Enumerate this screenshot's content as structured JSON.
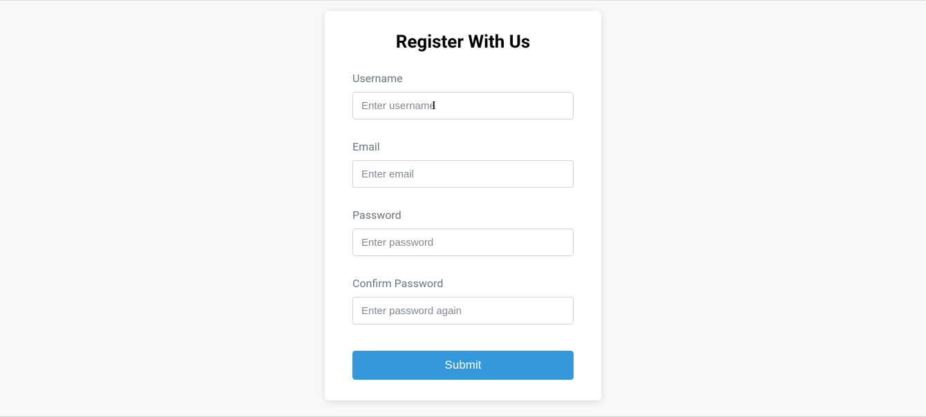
{
  "form": {
    "title": "Register With Us",
    "fields": {
      "username": {
        "label": "Username",
        "placeholder": "Enter username",
        "value": ""
      },
      "email": {
        "label": "Email",
        "placeholder": "Enter email",
        "value": ""
      },
      "password": {
        "label": "Password",
        "placeholder": "Enter password",
        "value": ""
      },
      "confirm_password": {
        "label": "Confirm Password",
        "placeholder": "Enter password again",
        "value": ""
      }
    },
    "submit_label": "Submit"
  }
}
